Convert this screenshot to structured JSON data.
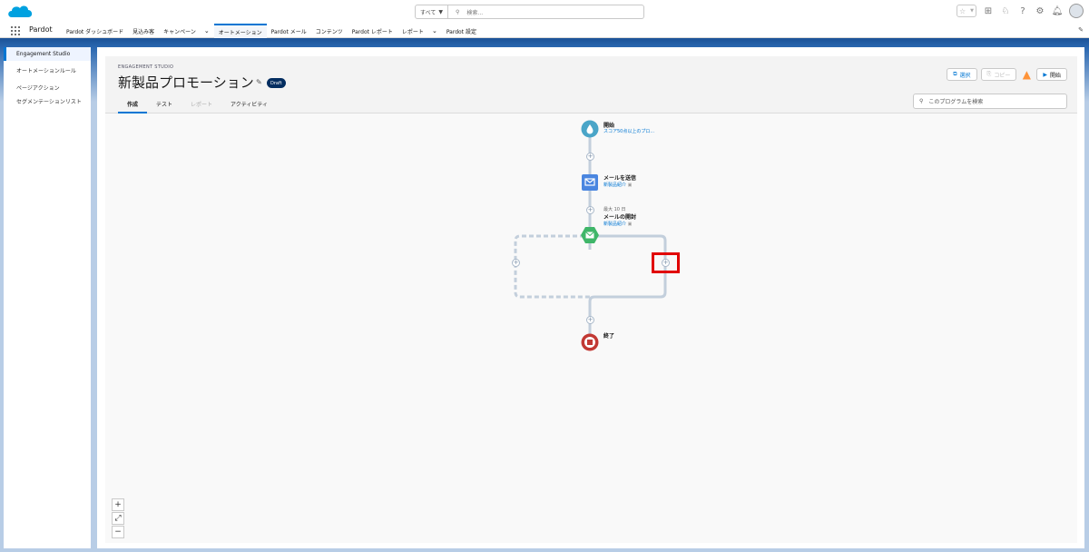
{
  "header": {
    "search_scope": "すべて",
    "search_placeholder": "検索..."
  },
  "nav": {
    "app_name": "Pardot",
    "items": [
      {
        "label": "Pardot ダッシュボード"
      },
      {
        "label": "見込み客"
      },
      {
        "label": "キャンペーン"
      },
      {
        "label": "オートメーション",
        "active": true
      },
      {
        "label": "Pardot メール"
      },
      {
        "label": "コンテンツ"
      },
      {
        "label": "Pardot レポート"
      },
      {
        "label": "レポート"
      },
      {
        "label": "Pardot 設定"
      }
    ]
  },
  "sidebar": {
    "items": [
      {
        "label": "Engagement Studio",
        "active": true
      },
      {
        "label": "オートメーションルール"
      },
      {
        "label": "ページアクション"
      },
      {
        "label": "セグメンテーションリスト"
      }
    ]
  },
  "program": {
    "eyebrow": "ENGAGEMENT STUDIO",
    "title": "新製品プロモーション",
    "status": "Draft",
    "tabs": [
      {
        "label": "作成",
        "active": true
      },
      {
        "label": "テスト"
      },
      {
        "label": "レポート",
        "disabled": true
      },
      {
        "label": "アクティビティ"
      }
    ],
    "buttons": {
      "select": "選択",
      "copy": "コピー",
      "start": "開始"
    },
    "search_placeholder": "このプログラムを検索"
  },
  "flow": {
    "start": {
      "label": "開始",
      "sub": "スコア50点以上のプロ..."
    },
    "send_email": {
      "label": "メールを送信",
      "sub": "新製品紹介"
    },
    "email_open": {
      "meta": "最大 10 日",
      "label": "メールの開封",
      "sub": "新製品紹介"
    },
    "end": {
      "label": "終了"
    }
  },
  "zoom": {
    "in": "+",
    "fit": "⤢",
    "out": "−"
  },
  "colors": {
    "accent": "#0176d3",
    "start_node": "#4aa5c8",
    "email_node": "#4a86e0",
    "condition_node": "#3fb669",
    "end_node": "#c23934",
    "highlight": "#e10000"
  }
}
